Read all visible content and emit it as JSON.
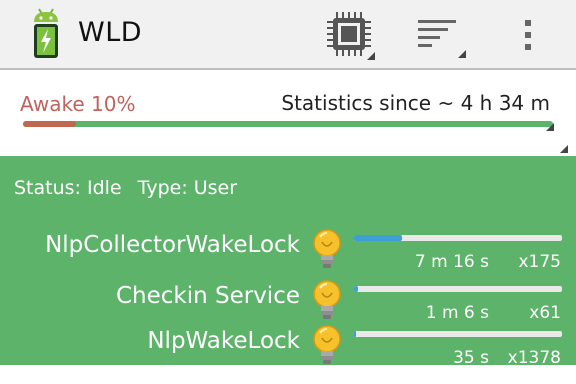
{
  "app": {
    "title": "WLD",
    "icon": "android-battery-icon"
  },
  "actionbar": {
    "actions": [
      {
        "name": "cpu-wakelocks-button",
        "icon": "cpu-chip-icon"
      },
      {
        "name": "sort-button",
        "icon": "sort-lines-icon"
      },
      {
        "name": "overflow-menu-button",
        "icon": "more-vert-icon"
      }
    ]
  },
  "stats": {
    "awake_label": "Awake 10%",
    "awake_fraction": 0.1,
    "since_label": "Statistics since ~ 4 h 34 m"
  },
  "status": {
    "status_text": "Status: Idle",
    "type_text": "Type: User"
  },
  "wakelocks": [
    {
      "name": "NlpCollectorWakeLock",
      "duration": "7 m 16 s",
      "count": "x175",
      "fraction": 0.23
    },
    {
      "name": "Checkin Service",
      "duration": "1 m 6 s",
      "count": "x61",
      "fraction": 0.02
    },
    {
      "name": "NlpWakeLock",
      "duration": "35 s",
      "count": "x1378",
      "fraction": 0.01
    }
  ],
  "colors": {
    "actionbar": "#f1f1f1",
    "awake": "#c0635d",
    "accent_green": "#5eb36b",
    "row_fill_blue": "#3e9fd6"
  }
}
